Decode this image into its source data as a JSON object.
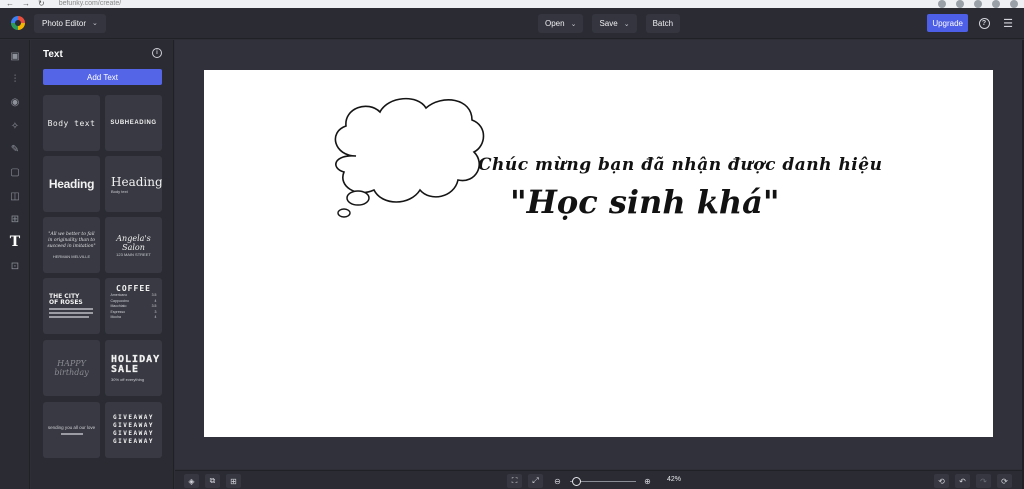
{
  "browser": {
    "url": "befunky.com/create/"
  },
  "topbar": {
    "app_menu_label": "Photo Editor",
    "open_label": "Open",
    "save_label": "Save",
    "batch_label": "Batch",
    "upgrade_label": "Upgrade",
    "accent_color": "#4d5fe6"
  },
  "rail": {
    "icons": [
      "edit-icon",
      "adjust-icon",
      "eye-icon",
      "effects-icon",
      "artsy-icon",
      "frames-icon",
      "graphics-icon",
      "overlays-icon",
      "text-icon",
      "textures-icon"
    ],
    "active": "text-icon"
  },
  "panel": {
    "title": "Text",
    "add_text_label": "Add Text",
    "tiles": {
      "body_text": "Body text",
      "subheading": "SUBHEADING",
      "heading": "Heading",
      "heading_serif": "Heading",
      "heading_serif_sub": "Body text",
      "quote_lines": [
        "\"All we better to fail",
        "in originality than to",
        "succeed in imitation\""
      ],
      "quote_author": "HERMAN MELVILLE",
      "salon_name": "Angela's Salon",
      "salon_sub": "123 MAIN STREET",
      "city_title": [
        "THE CITY",
        "OF ROSES"
      ],
      "coffee_title": "COFFEE",
      "coffee_menu": [
        {
          "item": "Americano",
          "price": "3.5"
        },
        {
          "item": "Cappuccino",
          "price": "4"
        },
        {
          "item": "Macchiato",
          "price": "3.5"
        },
        {
          "item": "Espresso",
          "price": "3"
        },
        {
          "item": "Mocha",
          "price": "4"
        }
      ],
      "happy": "HAPPY",
      "birthday": "birthday",
      "holiday": "HOLIDAY",
      "sale": "SALE",
      "sale_sub": "30% off everything",
      "sending": "sending you all our love",
      "giveaway": "GIVEAWAY"
    }
  },
  "canvas": {
    "line1": "Chúc mừng bạn đã nhận được danh hiệu",
    "line2": "\"Học sinh khá\""
  },
  "bottombar": {
    "zoom_label": "42%",
    "zoom_value": 42
  }
}
